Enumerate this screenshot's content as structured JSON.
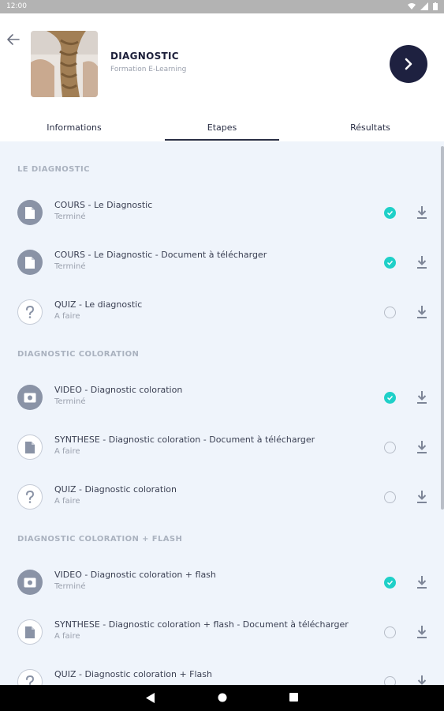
{
  "status_bar": {
    "time": "12:00"
  },
  "header": {
    "title": "DIAGNOSTIC",
    "subtitle": "Formation E-Learning"
  },
  "tabs": [
    {
      "label": "Informations",
      "active": false
    },
    {
      "label": "Etapes",
      "active": true
    },
    {
      "label": "Résultats",
      "active": false
    }
  ],
  "colors": {
    "accent_dark": "#1e2140",
    "done_check": "#1fd0c8",
    "content_bg": "#eff4fb"
  },
  "sections": [
    {
      "title": "LE DIAGNOSTIC",
      "items": [
        {
          "name": "COURS - Le Diagnostic",
          "status": "Terminé",
          "icon": "document-icon",
          "done": true
        },
        {
          "name": "COURS - Le Diagnostic - Document à télécharger",
          "status": "Terminé",
          "icon": "document-icon",
          "done": true
        },
        {
          "name": "QUIZ - Le diagnostic",
          "status": "A faire",
          "icon": "question-icon",
          "done": false
        }
      ]
    },
    {
      "title": "DIAGNOSTIC COLORATION",
      "items": [
        {
          "name": "VIDEO - Diagnostic coloration",
          "status": "Terminé",
          "icon": "video-icon",
          "done": true
        },
        {
          "name": "SYNTHESE - Diagnostic coloration - Document à télécharger",
          "status": "A faire",
          "icon": "document-icon",
          "done": false
        },
        {
          "name": "QUIZ - Diagnostic coloration",
          "status": "A faire",
          "icon": "question-icon",
          "done": false
        }
      ]
    },
    {
      "title": "DIAGNOSTIC COLORATION + FLASH",
      "items": [
        {
          "name": "VIDEO - Diagnostic coloration + flash",
          "status": "Terminé",
          "icon": "video-icon",
          "done": true
        },
        {
          "name": "SYNTHESE - Diagnostic coloration + flash - Document à télécharger",
          "status": "A faire",
          "icon": "document-icon",
          "done": false
        },
        {
          "name": "QUIZ - Diagnostic coloration + Flash",
          "status": "",
          "icon": "question-icon",
          "done": false
        }
      ]
    }
  ]
}
